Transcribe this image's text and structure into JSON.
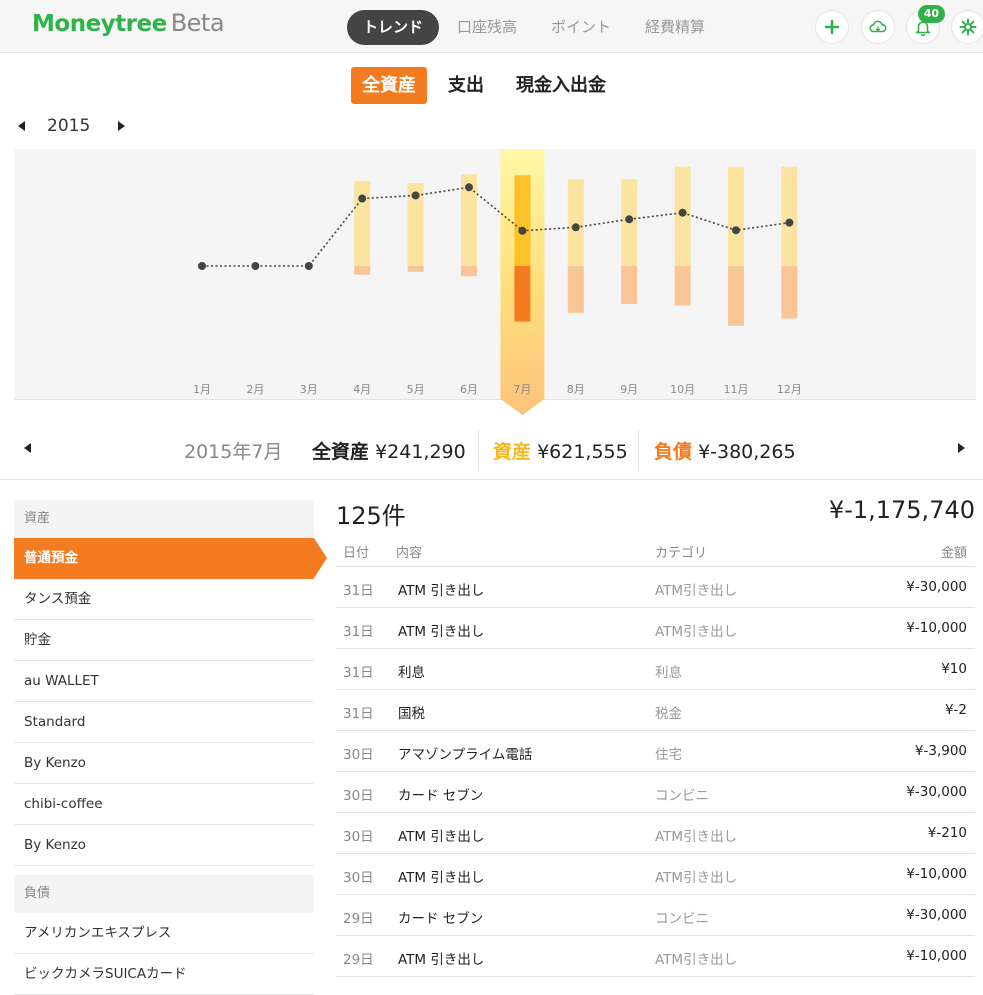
{
  "app": {
    "logo": "Moneytree",
    "logo_suffix": "Beta",
    "nav_tabs": [
      {
        "label": "トレンド",
        "active": true
      },
      {
        "label": "口座残高",
        "active": false
      },
      {
        "label": "ポイント",
        "active": false
      },
      {
        "label": "経費精算",
        "active": false
      }
    ],
    "notification_count": "40",
    "icons": [
      "plus-icon",
      "cloud-sync-icon",
      "bell-icon",
      "gear-icon"
    ],
    "accent_color": "#2db34a",
    "orange": "#f47b20"
  },
  "subtabs": [
    {
      "label": "全資産",
      "active": true
    },
    {
      "label": "支出",
      "active": false
    },
    {
      "label": "現金入出金",
      "active": false
    }
  ],
  "year": "2015",
  "chart_data": {
    "type": "bar",
    "categories": [
      "1月",
      "2月",
      "3月",
      "4月",
      "5月",
      "6月",
      "7月",
      "8月",
      "9月",
      "10月",
      "11月",
      "12月"
    ],
    "selected": "7月",
    "series": [
      {
        "values": [
          0,
          0,
          0,
          581000,
          568000,
          628000,
          621555,
          595000,
          595000,
          680000,
          680000,
          680000
        ]
      },
      {
        "values": [
          0,
          0,
          0,
          -60000,
          -40000,
          -70000,
          -380265,
          -320000,
          -260000,
          -270000,
          -410000,
          -360000
        ]
      },
      {
        "values": [
          0,
          0,
          0,
          462000,
          483000,
          539000,
          241290,
          265000,
          320000,
          365000,
          245000,
          297000
        ]
      }
    ]
  },
  "summary": {
    "period": "2015年7月",
    "total_label": "全資産",
    "total_value": "¥241,290",
    "assets_label": "資産",
    "assets_value": "¥621,555",
    "liabilities_label": "負債",
    "liabilities_value": "¥-380,265"
  },
  "sidebar": {
    "assets_header": "資産",
    "assets": [
      "普通預金",
      "タンス預金",
      "貯金",
      "au WALLET",
      "Standard",
      "By Kenzo",
      "chibi-coffee",
      "By Kenzo"
    ],
    "liabilities_header": "負債",
    "liabilities": [
      "アメリカンエキスプレス",
      "ビックカメラSUICAカード"
    ]
  },
  "transactions": {
    "count": "125件",
    "total": "¥-1,175,740",
    "headers": {
      "date": "日付",
      "desc": "内容",
      "category": "カテゴリ",
      "amount": "金額"
    },
    "rows": [
      {
        "date": "31日",
        "desc": "ATM 引き出し",
        "category": "ATM引き出し",
        "amount": "¥-30,000"
      },
      {
        "date": "31日",
        "desc": "ATM 引き出し",
        "category": "ATM引き出し",
        "amount": "¥-10,000"
      },
      {
        "date": "31日",
        "desc": "利息",
        "category": "利息",
        "amount": "¥10"
      },
      {
        "date": "31日",
        "desc": "国税",
        "category": "税金",
        "amount": "¥-2"
      },
      {
        "date": "30日",
        "desc": "アマゾンプライム電話",
        "category": "住宅",
        "amount": "¥-3,900"
      },
      {
        "date": "30日",
        "desc": "カード セブン",
        "category": "コンビニ",
        "amount": "¥-30,000"
      },
      {
        "date": "30日",
        "desc": "ATM 引き出し",
        "category": "ATM引き出し",
        "amount": "¥-210"
      },
      {
        "date": "30日",
        "desc": "ATM 引き出し",
        "category": "ATM引き出し",
        "amount": "¥-10,000"
      },
      {
        "date": "29日",
        "desc": "カード セブン",
        "category": "コンビニ",
        "amount": "¥-30,000"
      },
      {
        "date": "29日",
        "desc": "ATM 引き出し",
        "category": "ATM引き出し",
        "amount": "¥-10,000"
      }
    ]
  }
}
